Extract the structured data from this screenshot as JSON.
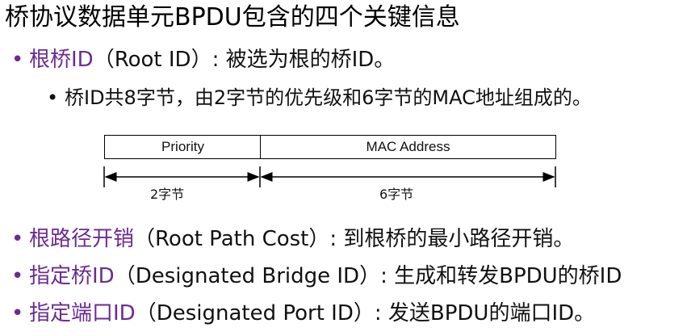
{
  "title": "桥协议数据单元BPDU包含的四个关键信息",
  "bullets": [
    {
      "term": "根桥ID",
      "en": "（Root ID）",
      "desc": ": 被选为根的桥ID。"
    },
    {
      "term": "根路径开销",
      "en": "（Root Path Cost）",
      "desc": ": 到根桥的最小路径开销。"
    },
    {
      "term": "指定桥ID",
      "en": "（Designated Bridge ID）",
      "desc": ": 生成和转发BPDU的桥ID"
    },
    {
      "term": "指定端口ID",
      "en": "（Designated Port ID）",
      "desc": ": 发送BPDU的端口ID。"
    }
  ],
  "sub_bullet": "桥ID共8字节，由2字节的优先级和6字节的MAC地址组成的。",
  "bridge_id_diagram": {
    "fields": [
      {
        "label": "Priority",
        "size": "2字节"
      },
      {
        "label": "MAC Address",
        "size": "6字节"
      }
    ]
  },
  "colors": {
    "term": "#6a2c91",
    "text": "#111111"
  },
  "bullet_glyph": "•"
}
